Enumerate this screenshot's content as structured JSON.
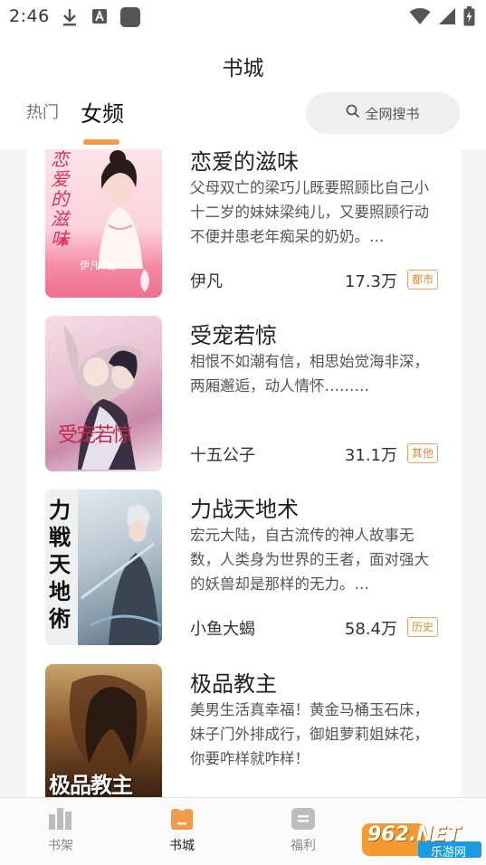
{
  "status_bar": {
    "time": "2:46"
  },
  "header": {
    "title": "书城",
    "tabs": [
      {
        "label": "热门"
      },
      {
        "label": "女频"
      }
    ],
    "search_label": "全网搜书"
  },
  "books": [
    {
      "title": "恋爱的滋味",
      "desc": "父母双亡的梁巧儿既要照顾比自己小十二岁的妹妹梁纯儿，又要照顾行动不便并患老年痴呆的奶奶。…",
      "author": "伊凡",
      "count": "17.3万",
      "tag": "都市",
      "cover_text": "恋爱的滋味",
      "cover_author": "伊凡 /著"
    },
    {
      "title": "受宠若惊",
      "desc": "相恨不如潮有信，相思始觉海非深，\n两厢邂逅，动人情怀………",
      "author": "十五公子",
      "count": "31.1万",
      "tag": "其他",
      "cover_text": "受宠若惊"
    },
    {
      "title": "力战天地术",
      "desc": "宏元大陆，自古流传的神人故事无数，人类身为世界的王者，面对强大的妖兽却是那样的无力。…",
      "author": "小鱼大蝎",
      "count": "58.4万",
      "tag": "历史",
      "cover_text": "力戦天地術"
    },
    {
      "title": "极品教主",
      "desc": "美男生活真幸福！黄金马桶玉石床，妹子门外排成行，御姐萝莉姐妹花，你要咋样就咋样！",
      "cover_text": "极品教主"
    }
  ],
  "bottom_nav": [
    {
      "label": "书架"
    },
    {
      "label": "书城"
    },
    {
      "label": "福利"
    }
  ],
  "watermark": {
    "text": "962.NET",
    "subtext": "乐游网"
  },
  "colors": {
    "accent": "#f3994a",
    "tag": "#e8863a"
  }
}
